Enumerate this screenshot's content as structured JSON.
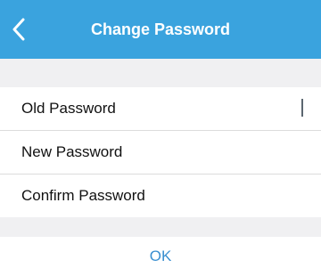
{
  "header": {
    "title": "Change Password",
    "back_icon": "chevron-left-icon"
  },
  "form": {
    "fields": [
      {
        "label": "Old Password",
        "value": "",
        "focused": true
      },
      {
        "label": "New Password",
        "value": ""
      },
      {
        "label": "Confirm Password",
        "value": ""
      }
    ]
  },
  "actions": {
    "ok_label": "OK"
  },
  "colors": {
    "header_bg": "#3aa3de",
    "section_bg": "#f0f0f2",
    "accent": "#3a8fd0",
    "divider": "#dcdcdc"
  }
}
